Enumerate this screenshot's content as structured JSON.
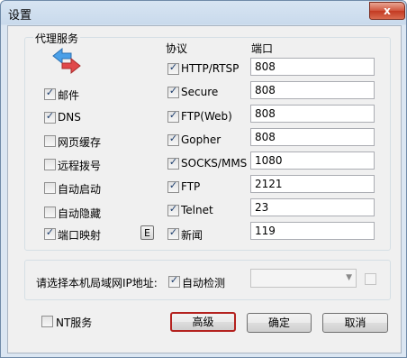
{
  "window": {
    "title": "设置",
    "close_glyph": "x"
  },
  "proxy_group": {
    "title": "代理服务",
    "icon": "bidirectional-arrows-icon",
    "left_options": [
      {
        "label": "邮件",
        "checked": true
      },
      {
        "label": "DNS",
        "checked": true
      },
      {
        "label": "网页缓存",
        "checked": false
      },
      {
        "label": "远程拨号",
        "checked": false
      },
      {
        "label": "自动启动",
        "checked": false
      },
      {
        "label": "自动隐藏",
        "checked": false
      },
      {
        "label": "端口映射",
        "checked": true
      }
    ],
    "port_map_button": "E",
    "protocol_header": "协议",
    "port_header": "端口",
    "protocols": [
      {
        "label": "HTTP/RTSP",
        "checked": true,
        "port": "808"
      },
      {
        "label": "Secure",
        "checked": true,
        "port": "808"
      },
      {
        "label": "FTP(Web)",
        "checked": true,
        "port": "808"
      },
      {
        "label": "Gopher",
        "checked": true,
        "port": "808"
      },
      {
        "label": "SOCKS/MMS",
        "checked": true,
        "port": "1080"
      },
      {
        "label": "FTP",
        "checked": true,
        "port": "2121"
      },
      {
        "label": "Telnet",
        "checked": true,
        "port": "23"
      },
      {
        "label": "新闻",
        "checked": true,
        "port": "119"
      }
    ]
  },
  "lan": {
    "label": "请选择本机局域网IP地址:",
    "auto_detect_label": "自动检测",
    "auto_detect_checked": true,
    "ip_value": "",
    "extra_checked": false
  },
  "footer": {
    "nt_service_label": "NT服务",
    "nt_service_checked": false,
    "advanced_label": "高级",
    "ok_label": "确定",
    "cancel_label": "取消"
  },
  "colors": {
    "accent_border": "#b4221f",
    "check_mark": "#1e3f6e",
    "arrow_blue": "#4aa0e8",
    "arrow_red": "#e0484a"
  }
}
